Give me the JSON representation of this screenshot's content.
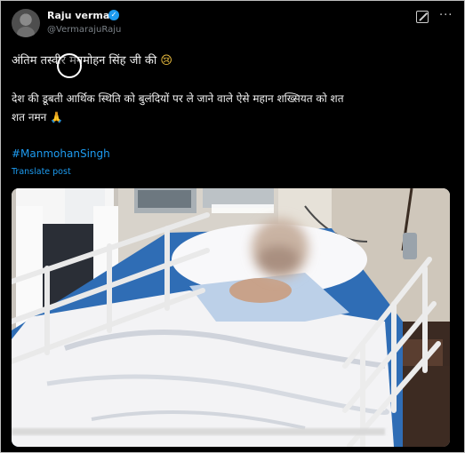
{
  "post": {
    "author_name": "Raju verma",
    "author_handle": "@VermarajuRaju",
    "verified": true,
    "text_line_1": "अंतिम तस्वीर मनमोहन सिंह जी की",
    "text_line_1_emoji": "😢",
    "text_line_2": "देश की डूबती आर्थिक स्थिति को बुलंदियों पर ले जाने वाले ऐसे महान शख्सियत को शत",
    "text_line_3": "शत नमन",
    "text_line_3_emoji": "🙏",
    "hashtag": "#ManmohanSingh",
    "translate_label": "Translate post"
  },
  "icons": {
    "verified": "verified-badge-icon",
    "grok": "grok-icon",
    "more": "more-options-icon"
  },
  "colors": {
    "background": "#000000",
    "text": "#f2f2f2",
    "link": "#1d9bf0",
    "muted": "#7b8288"
  }
}
